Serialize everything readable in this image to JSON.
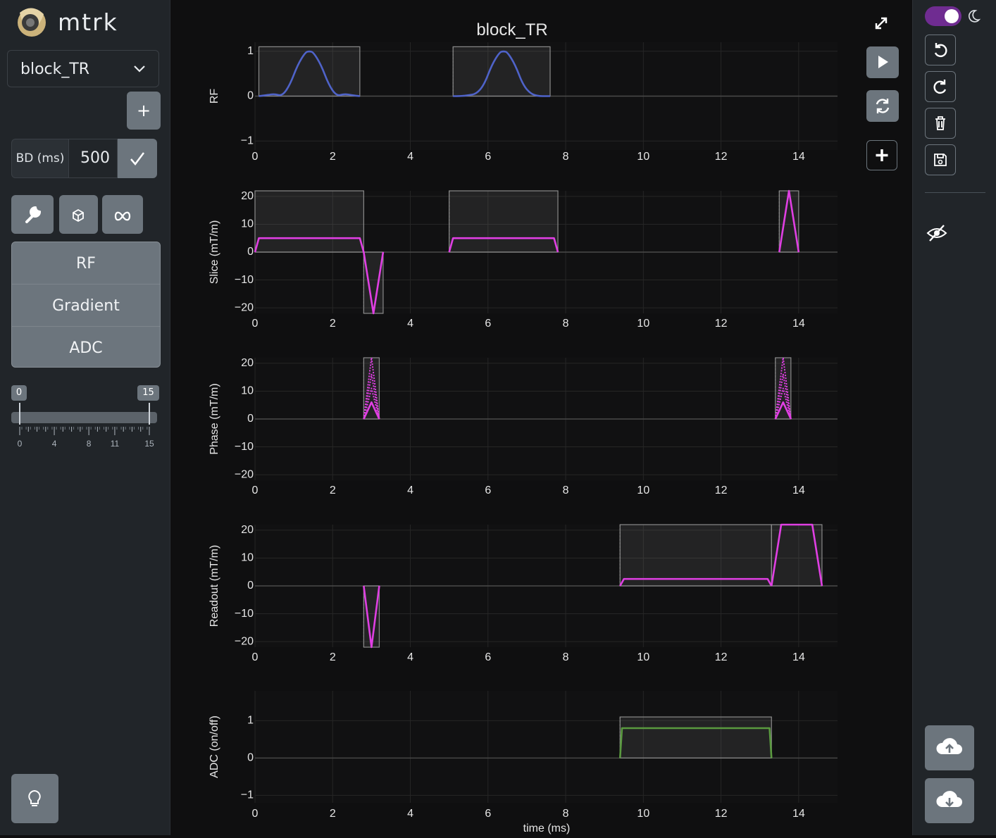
{
  "app": {
    "brand": "mtrk"
  },
  "sidebar": {
    "block_select": "block_TR",
    "add_label": "+",
    "bd_label": "BD (ms)",
    "bd_value": "500",
    "menu": [
      "RF",
      "Gradient",
      "ADC"
    ],
    "slider": {
      "min_label": "0",
      "max_label": "15",
      "ticks": [
        "0",
        "4",
        "8",
        "11",
        "15"
      ]
    }
  },
  "plot": {
    "title": "block_TR",
    "xlabel": "time (ms)",
    "x_ticks": [
      "0",
      "2",
      "4",
      "6",
      "8",
      "10",
      "12",
      "14"
    ],
    "colors": {
      "rf": "#4f63c9",
      "gradient": "#e03fe3",
      "adc": "#5a9a3f",
      "box": "#8a8a8a"
    }
  },
  "chart_data": [
    {
      "type": "line",
      "name": "RF",
      "ylabel": "RF",
      "xlim": [
        0,
        15
      ],
      "ylim": [
        -1.2,
        1.2
      ],
      "yticks": [
        "1",
        "0",
        "−1"
      ],
      "ytick_vals": [
        1,
        0,
        -1
      ],
      "boxes": [
        [
          0.1,
          2.7,
          0,
          1.1
        ],
        [
          5.1,
          7.6,
          0,
          1.1
        ]
      ],
      "series": [
        {
          "x": [
            0.1,
            0.3,
            0.5,
            0.7,
            0.9,
            1.1,
            1.3,
            1.4,
            1.5,
            1.7,
            1.9,
            2.1,
            2.3,
            2.5,
            2.7
          ],
          "y": [
            0,
            0.02,
            0.05,
            0,
            0.25,
            0.7,
            0.98,
            1.0,
            0.98,
            0.7,
            0.25,
            0,
            0.05,
            0.02,
            0
          ]
        },
        {
          "x": [
            5.1,
            5.3,
            5.5,
            5.7,
            5.9,
            6.1,
            6.3,
            6.4,
            6.5,
            6.7,
            6.9,
            7.1,
            7.3,
            7.5,
            7.6
          ],
          "y": [
            0,
            0,
            0.02,
            0.05,
            0.25,
            0.7,
            0.98,
            1.0,
            0.98,
            0.7,
            0.25,
            0.05,
            0,
            0,
            0
          ]
        }
      ]
    },
    {
      "type": "line",
      "name": "Slice",
      "ylabel": "Slice (mT/m)",
      "xlim": [
        0,
        15
      ],
      "ylim": [
        -22,
        22
      ],
      "yticks": [
        "20",
        "10",
        "0",
        "−10",
        "−20"
      ],
      "ytick_vals": [
        20,
        10,
        0,
        -10,
        -20
      ],
      "boxes": [
        [
          0.0,
          2.8,
          0,
          22
        ],
        [
          2.8,
          3.3,
          -22,
          0
        ],
        [
          5.0,
          7.8,
          0,
          22
        ],
        [
          13.5,
          14.0,
          0,
          22
        ]
      ],
      "series": [
        {
          "x": [
            0,
            0.1,
            2.7,
            2.8
          ],
          "y": [
            0,
            5,
            5,
            0
          ]
        },
        {
          "x": [
            2.8,
            3.05,
            3.3
          ],
          "y": [
            0,
            -22,
            0
          ]
        },
        {
          "x": [
            5.0,
            5.1,
            7.7,
            7.8
          ],
          "y": [
            0,
            5,
            5,
            0
          ]
        },
        {
          "x": [
            13.5,
            13.75,
            14.0
          ],
          "y": [
            0,
            22,
            0
          ]
        }
      ]
    },
    {
      "type": "line",
      "name": "Phase",
      "ylabel": "Phase (mT/m)",
      "xlim": [
        0,
        15
      ],
      "ylim": [
        -22,
        22
      ],
      "yticks": [
        "20",
        "10",
        "0",
        "−10",
        "−20"
      ],
      "ytick_vals": [
        20,
        10,
        0,
        -10,
        -20
      ],
      "boxes": [
        [
          2.8,
          3.2,
          0,
          22
        ],
        [
          13.4,
          13.8,
          0,
          22
        ]
      ],
      "series": [
        {
          "x": [
            2.8,
            3.0,
            3.2
          ],
          "y": [
            0,
            22,
            0
          ]
        },
        {
          "x": [
            2.8,
            3.0,
            3.2
          ],
          "y": [
            0,
            16,
            0
          ]
        },
        {
          "x": [
            2.8,
            3.0,
            3.2
          ],
          "y": [
            0,
            11,
            0
          ]
        },
        {
          "x": [
            2.8,
            3.0,
            3.2
          ],
          "y": [
            0,
            6,
            0
          ]
        },
        {
          "x": [
            13.4,
            13.6,
            13.8
          ],
          "y": [
            0,
            22,
            0
          ]
        },
        {
          "x": [
            13.4,
            13.6,
            13.8
          ],
          "y": [
            0,
            16,
            0
          ]
        },
        {
          "x": [
            13.4,
            13.6,
            13.8
          ],
          "y": [
            0,
            11,
            0
          ]
        },
        {
          "x": [
            13.4,
            13.6,
            13.8
          ],
          "y": [
            0,
            6,
            0
          ]
        }
      ]
    },
    {
      "type": "line",
      "name": "Readout",
      "ylabel": "Readout (mT/m)",
      "xlim": [
        0,
        15
      ],
      "ylim": [
        -22,
        22
      ],
      "yticks": [
        "20",
        "10",
        "0",
        "−10",
        "−20"
      ],
      "ytick_vals": [
        20,
        10,
        0,
        -10,
        -20
      ],
      "boxes": [
        [
          2.8,
          3.2,
          -22,
          0
        ],
        [
          9.4,
          13.3,
          0,
          22
        ],
        [
          13.3,
          14.6,
          0,
          22
        ]
      ],
      "series": [
        {
          "x": [
            2.8,
            3.0,
            3.2
          ],
          "y": [
            0,
            -22,
            0
          ]
        },
        {
          "x": [
            9.4,
            9.5,
            13.2,
            13.3
          ],
          "y": [
            0,
            2.5,
            2.5,
            0
          ]
        },
        {
          "x": [
            13.3,
            13.55,
            14.35,
            14.6
          ],
          "y": [
            0,
            22,
            22,
            0
          ]
        }
      ]
    },
    {
      "type": "line",
      "name": "ADC",
      "ylabel": "ADC (on/off)",
      "xlim": [
        0,
        15
      ],
      "ylim": [
        -1.2,
        1.8
      ],
      "yticks": [
        "1",
        "0",
        "−1"
      ],
      "ytick_vals": [
        1,
        0,
        -1
      ],
      "boxes": [
        [
          9.4,
          13.3,
          0,
          1.1
        ]
      ],
      "series": [
        {
          "x": [
            9.4,
            9.45,
            13.25,
            13.3
          ],
          "y": [
            0,
            0.8,
            0.8,
            0
          ]
        }
      ]
    }
  ],
  "icons": {
    "expand": "expand-icon",
    "play": "play-icon",
    "refresh": "refresh-icon",
    "add": "plus-icon",
    "undo": "undo-icon",
    "redo": "redo-icon",
    "delete": "trash-icon",
    "save": "save-icon",
    "hide": "eye-slash-icon",
    "upload": "cloud-upload-icon",
    "download": "cloud-download-icon",
    "hint": "lightbulb-icon",
    "theme": "moon-icon"
  }
}
